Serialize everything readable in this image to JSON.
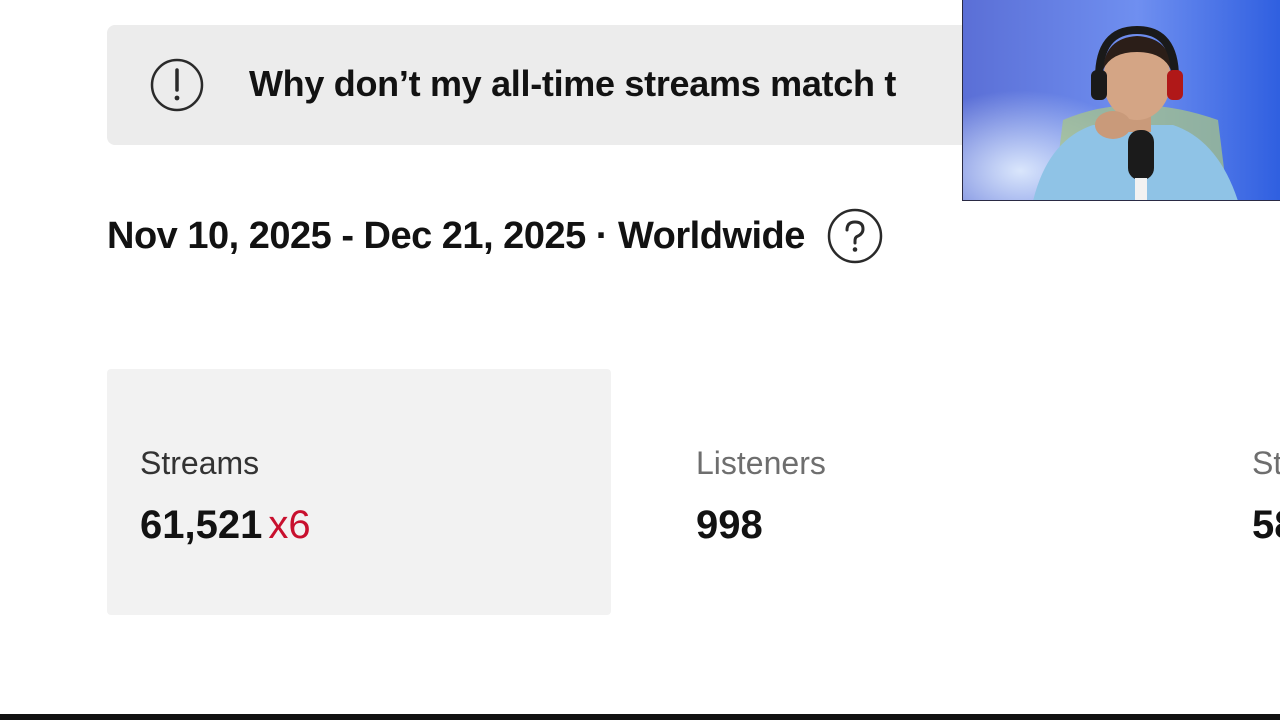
{
  "notice": {
    "icon": "exclamation-circle-icon",
    "text": "Why don’t my all-time streams match t"
  },
  "range": {
    "text": "Nov 10, 2025 - Dec 21, 2025 · Worldwide",
    "help_icon": "question-circle-icon"
  },
  "stats": [
    {
      "label": "Streams",
      "value": "61,521",
      "multiplier": "x6"
    },
    {
      "label": "Listeners",
      "value": "998"
    },
    {
      "label": "St",
      "value": "58"
    }
  ],
  "colors": {
    "multiplier": "#c8102e",
    "active_card_bg": "#f2f2f2",
    "notice_bg": "#ececec"
  },
  "webcam": {
    "description_icon": "webcam-feed"
  }
}
